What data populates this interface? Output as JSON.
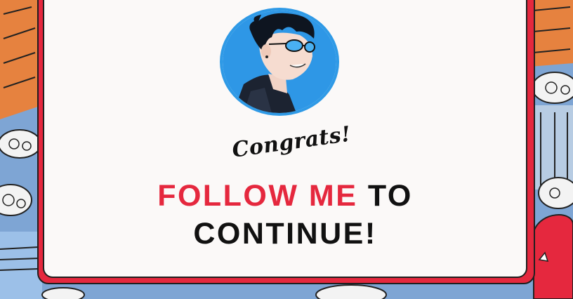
{
  "popup": {
    "avatar_alt": "Profile avatar",
    "congrats": "Congrats!",
    "headline": {
      "highlight": "FOLLOW ME",
      "rest": " TO",
      "line2": "CONTINUE!"
    }
  },
  "colors": {
    "accent_red": "#e5283e",
    "avatar_ring": "#2f9ae6",
    "card_bg": "#fbf9f8",
    "text": "#111111"
  },
  "icons": {
    "avatar": "anime-avatar-with-sunglasses"
  }
}
